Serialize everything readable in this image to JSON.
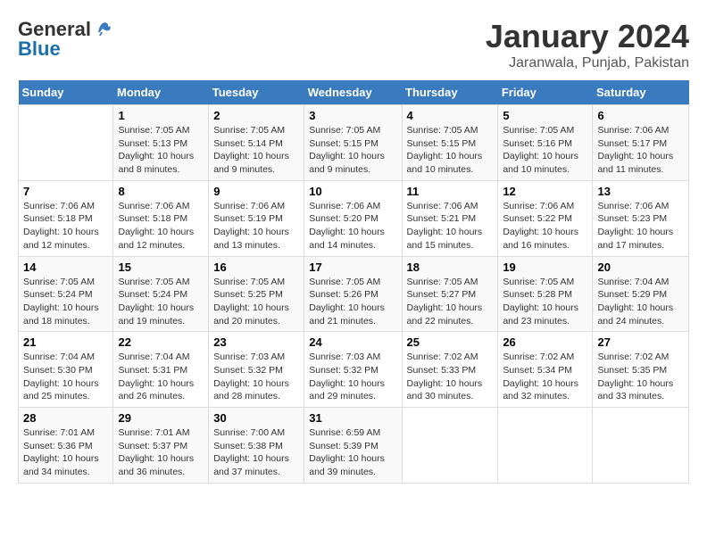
{
  "logo": {
    "general": "General",
    "blue": "Blue"
  },
  "header": {
    "month": "January 2024",
    "location": "Jaranwala, Punjab, Pakistan"
  },
  "weekdays": [
    "Sunday",
    "Monday",
    "Tuesday",
    "Wednesday",
    "Thursday",
    "Friday",
    "Saturday"
  ],
  "weeks": [
    [
      {
        "day": "",
        "info": ""
      },
      {
        "day": "1",
        "info": "Sunrise: 7:05 AM\nSunset: 5:13 PM\nDaylight: 10 hours\nand 8 minutes."
      },
      {
        "day": "2",
        "info": "Sunrise: 7:05 AM\nSunset: 5:14 PM\nDaylight: 10 hours\nand 9 minutes."
      },
      {
        "day": "3",
        "info": "Sunrise: 7:05 AM\nSunset: 5:15 PM\nDaylight: 10 hours\nand 9 minutes."
      },
      {
        "day": "4",
        "info": "Sunrise: 7:05 AM\nSunset: 5:15 PM\nDaylight: 10 hours\nand 10 minutes."
      },
      {
        "day": "5",
        "info": "Sunrise: 7:05 AM\nSunset: 5:16 PM\nDaylight: 10 hours\nand 10 minutes."
      },
      {
        "day": "6",
        "info": "Sunrise: 7:06 AM\nSunset: 5:17 PM\nDaylight: 10 hours\nand 11 minutes."
      }
    ],
    [
      {
        "day": "7",
        "info": "Sunrise: 7:06 AM\nSunset: 5:18 PM\nDaylight: 10 hours\nand 12 minutes."
      },
      {
        "day": "8",
        "info": "Sunrise: 7:06 AM\nSunset: 5:18 PM\nDaylight: 10 hours\nand 12 minutes."
      },
      {
        "day": "9",
        "info": "Sunrise: 7:06 AM\nSunset: 5:19 PM\nDaylight: 10 hours\nand 13 minutes."
      },
      {
        "day": "10",
        "info": "Sunrise: 7:06 AM\nSunset: 5:20 PM\nDaylight: 10 hours\nand 14 minutes."
      },
      {
        "day": "11",
        "info": "Sunrise: 7:06 AM\nSunset: 5:21 PM\nDaylight: 10 hours\nand 15 minutes."
      },
      {
        "day": "12",
        "info": "Sunrise: 7:06 AM\nSunset: 5:22 PM\nDaylight: 10 hours\nand 16 minutes."
      },
      {
        "day": "13",
        "info": "Sunrise: 7:06 AM\nSunset: 5:23 PM\nDaylight: 10 hours\nand 17 minutes."
      }
    ],
    [
      {
        "day": "14",
        "info": "Sunrise: 7:05 AM\nSunset: 5:24 PM\nDaylight: 10 hours\nand 18 minutes."
      },
      {
        "day": "15",
        "info": "Sunrise: 7:05 AM\nSunset: 5:24 PM\nDaylight: 10 hours\nand 19 minutes."
      },
      {
        "day": "16",
        "info": "Sunrise: 7:05 AM\nSunset: 5:25 PM\nDaylight: 10 hours\nand 20 minutes."
      },
      {
        "day": "17",
        "info": "Sunrise: 7:05 AM\nSunset: 5:26 PM\nDaylight: 10 hours\nand 21 minutes."
      },
      {
        "day": "18",
        "info": "Sunrise: 7:05 AM\nSunset: 5:27 PM\nDaylight: 10 hours\nand 22 minutes."
      },
      {
        "day": "19",
        "info": "Sunrise: 7:05 AM\nSunset: 5:28 PM\nDaylight: 10 hours\nand 23 minutes."
      },
      {
        "day": "20",
        "info": "Sunrise: 7:04 AM\nSunset: 5:29 PM\nDaylight: 10 hours\nand 24 minutes."
      }
    ],
    [
      {
        "day": "21",
        "info": "Sunrise: 7:04 AM\nSunset: 5:30 PM\nDaylight: 10 hours\nand 25 minutes."
      },
      {
        "day": "22",
        "info": "Sunrise: 7:04 AM\nSunset: 5:31 PM\nDaylight: 10 hours\nand 26 minutes."
      },
      {
        "day": "23",
        "info": "Sunrise: 7:03 AM\nSunset: 5:32 PM\nDaylight: 10 hours\nand 28 minutes."
      },
      {
        "day": "24",
        "info": "Sunrise: 7:03 AM\nSunset: 5:32 PM\nDaylight: 10 hours\nand 29 minutes."
      },
      {
        "day": "25",
        "info": "Sunrise: 7:02 AM\nSunset: 5:33 PM\nDaylight: 10 hours\nand 30 minutes."
      },
      {
        "day": "26",
        "info": "Sunrise: 7:02 AM\nSunset: 5:34 PM\nDaylight: 10 hours\nand 32 minutes."
      },
      {
        "day": "27",
        "info": "Sunrise: 7:02 AM\nSunset: 5:35 PM\nDaylight: 10 hours\nand 33 minutes."
      }
    ],
    [
      {
        "day": "28",
        "info": "Sunrise: 7:01 AM\nSunset: 5:36 PM\nDaylight: 10 hours\nand 34 minutes."
      },
      {
        "day": "29",
        "info": "Sunrise: 7:01 AM\nSunset: 5:37 PM\nDaylight: 10 hours\nand 36 minutes."
      },
      {
        "day": "30",
        "info": "Sunrise: 7:00 AM\nSunset: 5:38 PM\nDaylight: 10 hours\nand 37 minutes."
      },
      {
        "day": "31",
        "info": "Sunrise: 6:59 AM\nSunset: 5:39 PM\nDaylight: 10 hours\nand 39 minutes."
      },
      {
        "day": "",
        "info": ""
      },
      {
        "day": "",
        "info": ""
      },
      {
        "day": "",
        "info": ""
      }
    ]
  ]
}
